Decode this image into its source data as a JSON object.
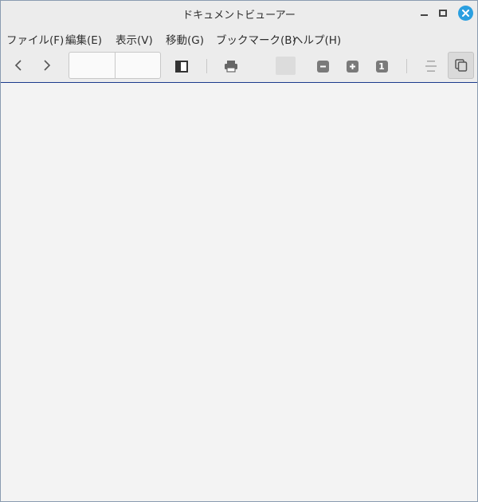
{
  "window": {
    "title": "ドキュメントビューアー"
  },
  "window_controls": {
    "icons": [
      "minimize-icon",
      "maximize-icon",
      "close-icon"
    ],
    "close_color": "#2a9fe0"
  },
  "menubar": {
    "items": [
      {
        "label": "ファイル(F)"
      },
      {
        "label": "編集(E)"
      },
      {
        "label": "表示(V)"
      },
      {
        "label": "移動(G)"
      },
      {
        "label": "ブックマーク(B)"
      },
      {
        "label": "ヘルプ(H)"
      }
    ]
  },
  "toolbar": {
    "icons": [
      "back-icon",
      "forward-icon",
      "sidebar-toggle-icon",
      "print-icon",
      "zoom-out-icon",
      "zoom-in-icon",
      "actual-size-icon",
      "continuous-icon",
      "dual-page-icon"
    ],
    "page_number_value": "",
    "page_count_value": "",
    "actual_size_label": "1"
  },
  "colors": {
    "chrome_bg": "#ececec",
    "content_bg": "#f3f3f3",
    "accent": "#2a9fe0"
  }
}
